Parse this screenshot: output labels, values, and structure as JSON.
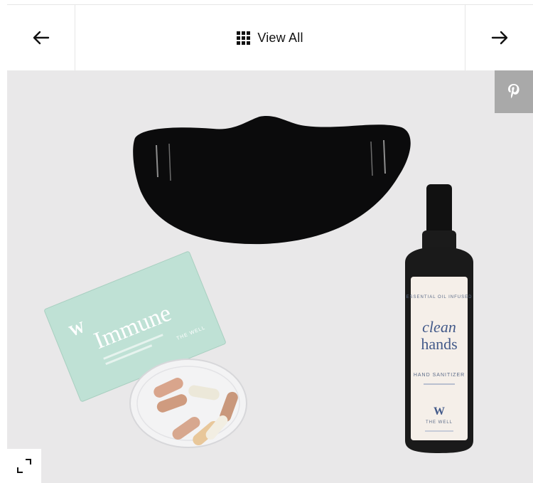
{
  "nav": {
    "prev_icon": "arrow-left-icon",
    "view_all_label": "View All",
    "view_all_icon": "grid-icon",
    "next_icon": "arrow-right-icon"
  },
  "image": {
    "pin_icon": "pinterest-icon",
    "expand_icon": "expand-icon",
    "products": {
      "packet_brand": "W",
      "packet_title": "Immune",
      "packet_side_label": "THE WELL",
      "bottle_top_label": "ESSENTIAL OIL INFUSED",
      "bottle_title_line1": "clean",
      "bottle_title_line2": "hands",
      "bottle_subtitle": "HAND SANITIZER",
      "bottle_brand_logo": "W",
      "bottle_brand_name": "THE WELL"
    }
  },
  "colors": {
    "background": "#e9e8e9",
    "pin_button": "#a9a9a9"
  }
}
